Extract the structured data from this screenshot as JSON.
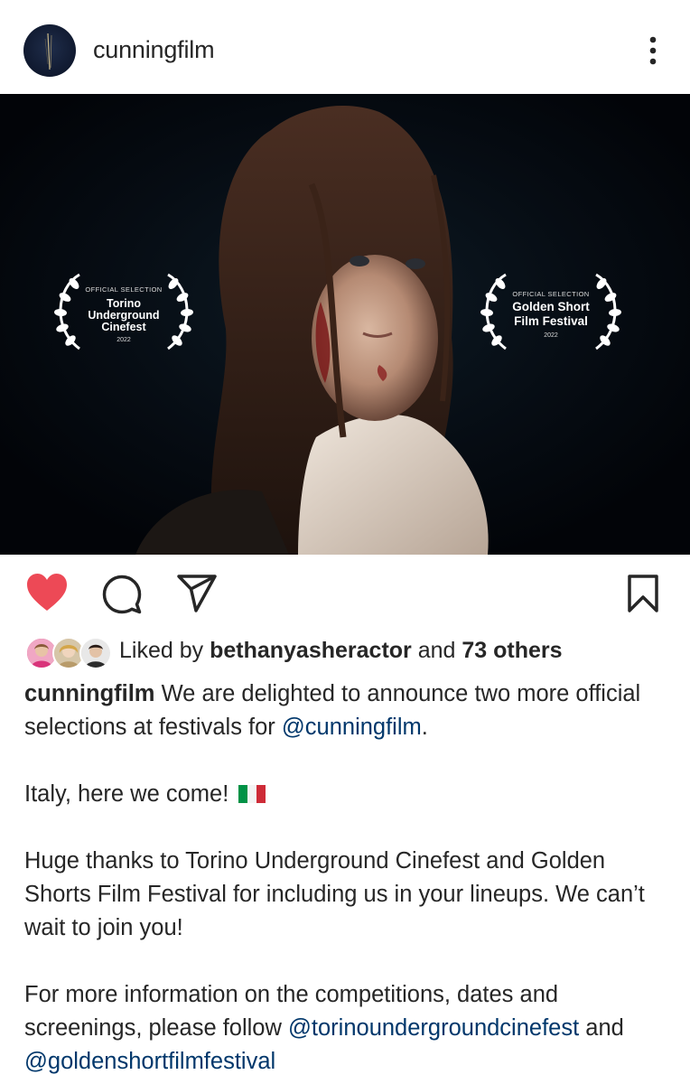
{
  "header": {
    "username": "cunningfilm",
    "avatar_icon": "film-logo-icon",
    "more_icon": "more-vertical-icon"
  },
  "post_image": {
    "laurels": [
      {
        "overline": "OFFICIAL SELECTION",
        "lines": [
          "Torino",
          "Underground",
          "Cinefest"
        ],
        "year": "2022"
      },
      {
        "overline": "OFFICIAL SELECTION",
        "lines": [
          "Golden Short",
          "Film Festival"
        ],
        "year": "2022"
      }
    ]
  },
  "actions": {
    "like_icon": "heart-filled-icon",
    "comment_icon": "comment-icon",
    "share_icon": "send-icon",
    "save_icon": "bookmark-icon",
    "like_color": "#ed4956"
  },
  "likes": {
    "prefix": "Liked by",
    "user": "bethanyasheractor",
    "connector": "and",
    "others": "73 others"
  },
  "caption": {
    "author": "cunningfilm",
    "p1_text": "We are delighted to announce two more official selections at festivals for",
    "p1_mention": "@cunningfilm",
    "p1_end": ".",
    "p2_text": "Italy, here we come!",
    "p2_flag": "italy-flag-icon",
    "p3_text": "Huge thanks to Torino Underground Cinefest and Golden Shorts Film Festival for including us in your lineups. We can’t wait to join you!",
    "p4_text": "For more information on the competitions, dates and screenings, please follow",
    "p4_mention1": "@torinoundergroundcinefest",
    "p4_connector": "and",
    "p4_mention2": "@goldenshortfilmfestival"
  },
  "colors": {
    "link": "#00376b",
    "text": "#262626",
    "like_red": "#ed4956"
  }
}
